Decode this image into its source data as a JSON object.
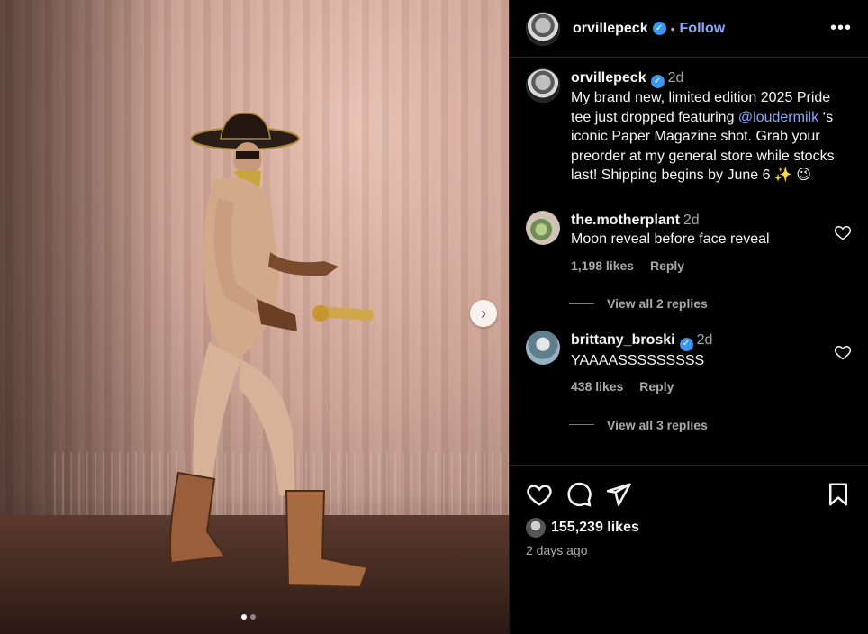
{
  "post": {
    "username": "orvillepeck",
    "follow_label": "Follow",
    "separator": "•",
    "more": "•••"
  },
  "caption": {
    "username": "orvillepeck",
    "time": "2d",
    "text_before": "My brand new, limited edition 2025 Pride tee just dropped featuring ",
    "mention": "@loudermilk",
    "text_after": " ‘s iconic Paper Magazine shot. Grab your preorder at my general store while stocks last! Shipping begins by June 6 ✨ 😉"
  },
  "comments": [
    {
      "username": "the.motherplant",
      "time": "2d",
      "text": "Moon reveal before face reveal",
      "likes": "1,198 likes",
      "reply": "Reply",
      "view_replies": "View all 2 replies"
    },
    {
      "username": "brittany_broski",
      "time": "2d",
      "text": "YAAAASSSSSSSSS",
      "likes": "438 likes",
      "reply": "Reply",
      "view_replies": "View all 3 replies"
    }
  ],
  "footer": {
    "likes": "155,239 likes",
    "posted": "2 days ago"
  },
  "carousel": {
    "next_glyph": "›",
    "total": 2,
    "current": 1
  },
  "colors": {
    "accent": "#86a8ff",
    "verified": "#3897f0",
    "muted": "#a8a8a8",
    "background": "#000000"
  },
  "icons": {
    "verified": "verified-badge-icon",
    "like": "heart-icon",
    "comment": "comment-bubble-icon",
    "share": "paper-plane-icon",
    "save": "bookmark-icon",
    "next": "chevron-right-icon"
  }
}
